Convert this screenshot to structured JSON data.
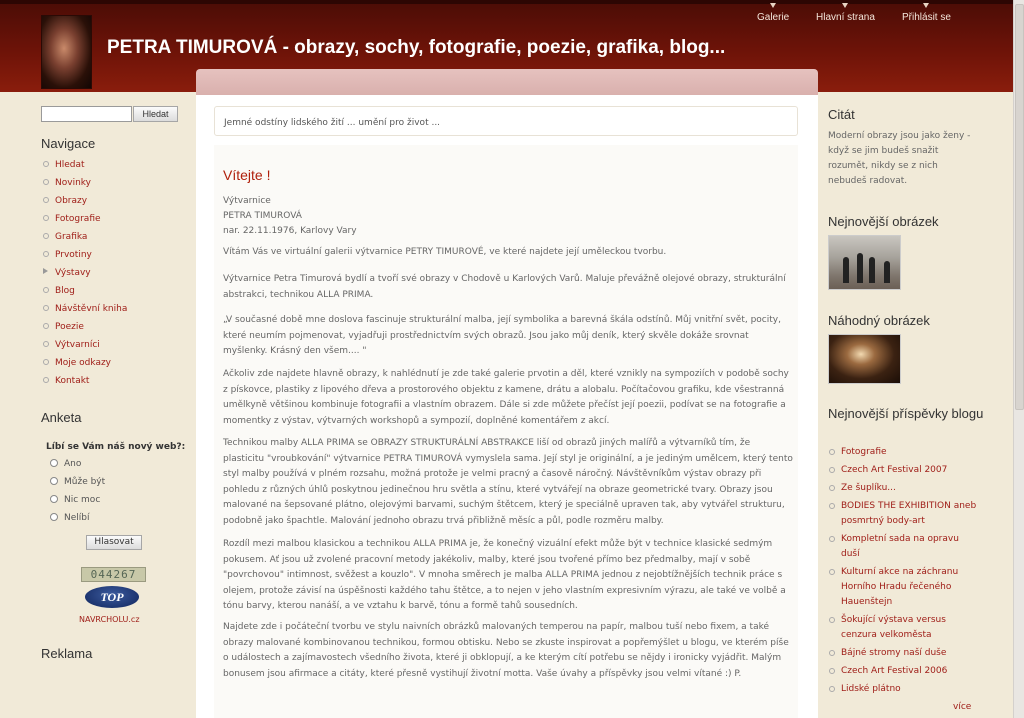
{
  "header": {
    "title": "PETRA TIMUROVÁ - obrazy, sochy, fotografie, poezie, grafika, blog...",
    "top_nav": [
      "Galerie",
      "Hlavní strana",
      "Přihlásit se"
    ]
  },
  "search": {
    "button_label": "Hledat",
    "value": ""
  },
  "navigation": {
    "heading": "Navigace",
    "items": [
      "Hledat",
      "Novinky",
      "Obrazy",
      "Fotografie",
      "Grafika",
      "Prvotiny",
      "Výstavy",
      "Blog",
      "Návštěvní kniha",
      "Poezie",
      "Výtvarníci",
      "Moje odkazy",
      "Kontakt"
    ]
  },
  "poll": {
    "heading": "Anketa",
    "question": "Líbí se Vám náš nový web?:",
    "options": [
      "Ano",
      "Může být",
      "Nic moc",
      "Nelíbí"
    ],
    "vote_label": "Hlasovat"
  },
  "counter": "044267",
  "toplist": {
    "logo_text": "TOP",
    "caption": "NAVRCHOLU.cz"
  },
  "ads_heading": "Reklama",
  "main": {
    "tagline": "Jemné odstíny lidského žití ... umění pro život ...",
    "welcome_title": "Vítejte !",
    "intro": [
      "Výtvarnice",
      "PETRA TIMUROVÁ",
      "nar. 22.11.1976, Karlovy Vary"
    ],
    "paragraphs": [
      "Vítám Vás ve virtuální galerii výtvarnice PETRY TIMUROVÉ, ve které najdete její uměleckou tvorbu.",
      "Výtvarnice Petra Timurová bydlí a tvoří své obrazy v Chodově u Karlových Varů. Maluje převážně olejové obrazy, strukturální abstrakci, technikou ALLA PRIMA.",
      "„V současné době mne doslova fascinuje strukturální malba, její symbolika a barevná škála odstínů. Můj vnitřní svět, pocity, které neumím pojmenovat, vyjadřuji prostřednictvím svých obrazů. Jsou jako můj deník, který skvěle dokáže srovnat myšlenky. Krásný den všem.... \"",
      "Ačkoliv zde najdete hlavně obrazy, k nahlédnutí je zde také galerie prvotin a děl, které vznikly na sympoziích v podobě sochy z pískovce, plastiky z lipového dřeva a prostorového objektu z kamene, drátu a alobalu. Počítačovou grafiku, kde všestranná umělkyně většinou kombinuje fotografii a vlastním obrazem. Dále si zde můžete přečíst její poezii, podívat se na fotografie a momentky z výstav, výtvarných workshopů a sympozií, doplněné komentářem z akcí.",
      "Technikou malby ALLA PRIMA se OBRAZY STRUKTURÁLNÍ ABSTRAKCE liší od obrazů jiných malířů a výtvarníků tím, že plasticitu \"vroubkování\" výtvarnice PETRA TIMUROVÁ vymyslela sama. Její styl je originální, a je jediným umělcem, který tento styl malby používá v plném rozsahu, možná protože je velmi pracný a časově náročný. Návštěvníkům výstav obrazy při pohledu z různých úhlů poskytnou jedinečnou hru světla a stínu, které vytvářejí na obraze geometrické tvary. Obrazy jsou malované na šepsované plátno, olejovými barvami, suchým štětcem, který je speciálně upraven tak, aby vytvářel strukturu, podobně jako špachtle. Malování jednoho obrazu trvá přibližně měsíc a půl, podle rozměru malby.",
      "Rozdíl mezi malbou klasickou a technikou ALLA PRIMA je, že konečný vizuální efekt může být v technice klasické sedmým pokusem. Ať jsou už zvolené pracovní metody jakékoliv, malby, které jsou tvořené přímo bez předmalby, mají v sobě \"povrchovou\" intimnost, svěžest a kouzlo\". V mnoha směrech je malba ALLA PRIMA jednou z nejobtížnějších technik práce s olejem, protože závisí na úspěšnosti každého tahu štětce, a to nejen v jeho vlastním expresivním výrazu, ale také ve volbě a tónu barvy, kterou nanáší, a ve vztahu k barvě, tónu a formě tahů sousedních.",
      "Najdete zde i počáteční tvorbu ve stylu naivních obrázků malovaných temperou na papír, malbou tuší nebo fixem, a také obrazy malované kombinovanou technikou, formou obtisku. Nebo se zkuste inspirovat a popřemýšlet u blogu, ve kterém píše o událostech a zajímavostech všedního života, které ji obklopují, a ke kterým cítí potřebu se nějdy i ironicky vyjádřit. Malým bonusem jsou afirmace a citáty, které přesně vystihují životní motta. Vaše úvahy a příspěvky jsou velmi vítané :) P."
    ]
  },
  "right": {
    "quote_heading": "Citát",
    "quote": "Moderní obrazy jsou jako ženy - když se jim budeš snažit rozumět, nikdy se z nich nebudeš radovat.",
    "latest_image_heading": "Nejnovější obrázek",
    "random_image_heading": "Náhodný obrázek",
    "latest_posts_heading": "Nejnovější příspěvky blogu",
    "posts": [
      "Fotografie",
      "Czech Art Festival 2007",
      "Ze šuplíku...",
      "BODIES THE EXHIBITION aneb posmrtný body-art",
      "Kompletní sada na opravu duší",
      "Kulturní akce na záchranu Horního Hradu řečeného Hauenštejn",
      "Šokující výstava versus cenzura velkoměsta",
      "Bájné stromy naší duše",
      "Czech Art Festival 2006",
      "Lidské plátno"
    ],
    "more_label": "více"
  }
}
